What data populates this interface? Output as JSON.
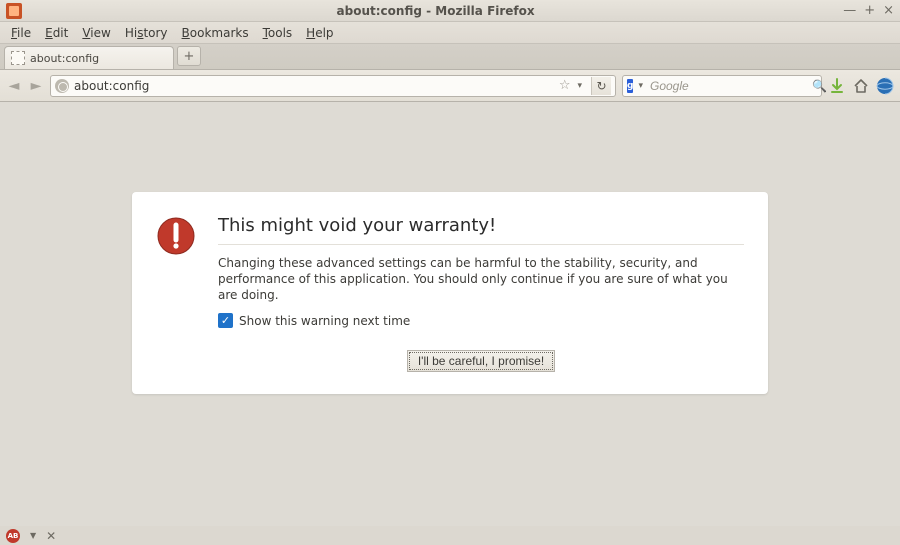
{
  "window": {
    "title": "about:config - Mozilla Firefox"
  },
  "menu": {
    "items": [
      "File",
      "Edit",
      "View",
      "History",
      "Bookmarks",
      "Tools",
      "Help"
    ]
  },
  "tabs": {
    "items": [
      {
        "label": "about:config"
      }
    ],
    "newtab_glyph": "+"
  },
  "urlbar": {
    "url": "about:config",
    "reload_glyph": "↻",
    "star_glyph": "☆",
    "dropdown_glyph": "▾"
  },
  "search": {
    "engine_badge": "g",
    "placeholder": "Google",
    "dropdown_glyph": "▾",
    "go_glyph": "🔍"
  },
  "warning": {
    "title": "This might void your warranty!",
    "description": "Changing these advanced settings can be harmful to the stability, security, and performance of this application. You should only continue if you are sure of what you are doing.",
    "checkbox_label": "Show this warning next time",
    "checkbox_checked": true,
    "button_label": "I'll be careful, I promise!"
  },
  "nav_glyphs": {
    "back": "◄",
    "forward": "►"
  },
  "colors": {
    "chrome": "#dcd8d0",
    "content_bg": "#dedbd4",
    "panel_bg": "#ffffff",
    "text": "#3c3b37",
    "warn_red": "#c0392b",
    "check_blue": "#1f72c9"
  }
}
